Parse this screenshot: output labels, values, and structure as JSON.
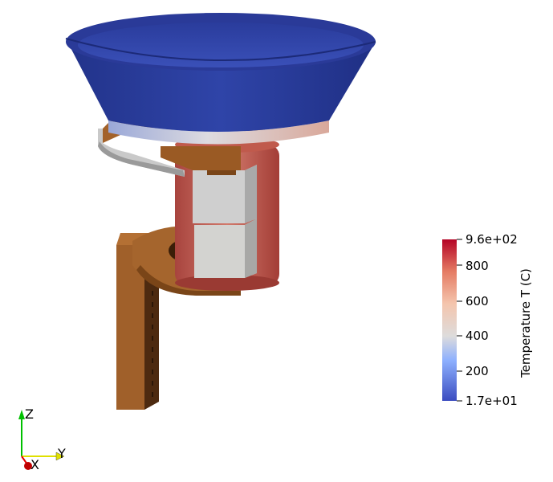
{
  "colorbar": {
    "title": "Temperature T (C)",
    "max_label": "9.6e+02",
    "min_label": "1.7e+01",
    "ticks": [
      "800",
      "600",
      "400",
      "200"
    ],
    "min": 17,
    "max": 960,
    "tick_values": [
      800,
      600,
      400,
      200
    ],
    "colors": {
      "high": "#b40426",
      "mid": "#dddcdc",
      "low": "#3b4cc0"
    }
  },
  "orientation_axes": {
    "z_label": "Z",
    "y_label": "Y",
    "x_label": "X",
    "colors": {
      "z": "#00c000",
      "y": "#ffff00",
      "x": "#e00000"
    }
  },
  "scene": {
    "colors": {
      "bowl": "#2c3f9e",
      "copper": "#a0602a",
      "insulation": "#c8c8c8",
      "cylinder_hot": "#c0504a"
    }
  }
}
